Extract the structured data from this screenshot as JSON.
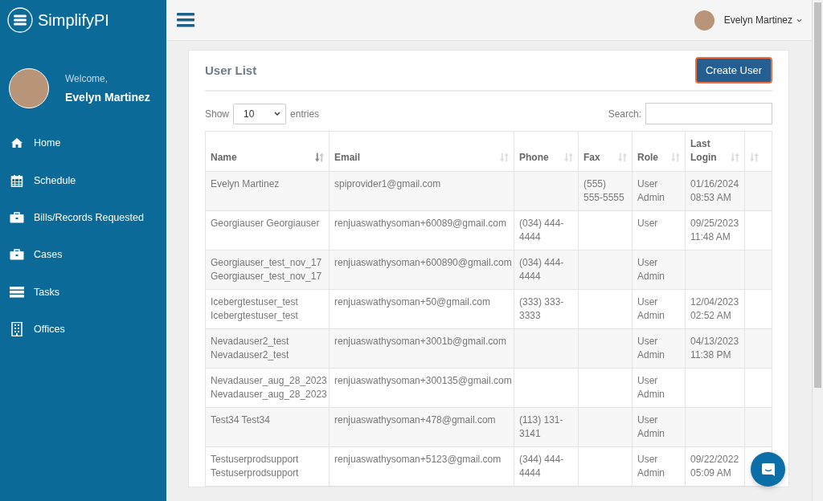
{
  "sidebar": {
    "brand": "SimplifyPI",
    "welcome": "Welcome,",
    "user_name": "Evelyn Martinez",
    "items": [
      {
        "label": "Home",
        "kind": "home"
      },
      {
        "label": "Schedule",
        "kind": "calendar"
      },
      {
        "label": "Bills/Records Requested",
        "kind": "briefcase"
      },
      {
        "label": "Cases",
        "kind": "briefcase"
      },
      {
        "label": "Tasks",
        "kind": "tasks"
      },
      {
        "label": "Offices",
        "kind": "building"
      }
    ]
  },
  "topbar": {
    "user_name": "Evelyn Martinez"
  },
  "card": {
    "title": "User List",
    "create_button": "Create User",
    "show_label": "Show",
    "entries_value": "10",
    "entries_label": "entries",
    "search_label": "Search:"
  },
  "table": {
    "columns": [
      {
        "label": "Name",
        "sorted": true
      },
      {
        "label": "Email",
        "sorted": false
      },
      {
        "label": "Phone",
        "sorted": false
      },
      {
        "label": "Fax",
        "sorted": false
      },
      {
        "label": "Role",
        "sorted": false
      },
      {
        "label": "Last Login",
        "sorted": false
      },
      {
        "sorted": false
      }
    ],
    "rows": [
      [
        "Evelyn Martinez",
        "spiprovider1@gmail.com",
        "",
        "(555) 555-5555",
        "User Admin",
        "01/16/2024 08:53 AM",
        ""
      ],
      [
        "Georgiauser Georgiauser",
        "renjuaswathysoman+60089@gmail.com",
        "(034) 444-4444",
        "",
        "User",
        "09/25/2023 11:48 AM",
        ""
      ],
      [
        "Georgiauser_test_nov_17 Georgiauser_test_nov_17",
        "renjuaswathysoman+600890@gmail.com",
        "(034) 444-4444",
        "",
        "User Admin",
        "",
        ""
      ],
      [
        "Icebergtestuser_test Icebergtestuser_test",
        "renjuaswathysoman+50@gmail.com",
        "(333) 333-3333",
        "",
        "User Admin",
        "12/04/2023 02:52 AM",
        ""
      ],
      [
        "Nevadauser2_test Nevadauser2_test",
        "renjuaswathysoman+3001b@gmail.com",
        "",
        "",
        "User Admin",
        "04/13/2023 11:38 PM",
        ""
      ],
      [
        "Nevadauser_aug_28_2023 Nevadauser_aug_28_2023",
        "renjuaswathysoman+300135@gmail.com",
        "",
        "",
        "User Admin",
        "",
        ""
      ],
      [
        "Test34 Test34",
        "renjuaswathysoman+478@gmail.com",
        "(113) 131-3141",
        "",
        "User Admin",
        "",
        ""
      ],
      [
        "Testuserprodsupport Testuserprodsupport",
        "renjuaswathysoman+5123@gmail.com",
        "(344) 444-4444",
        "",
        "User Admin",
        "09/22/2022 05:09 AM",
        ""
      ]
    ]
  }
}
